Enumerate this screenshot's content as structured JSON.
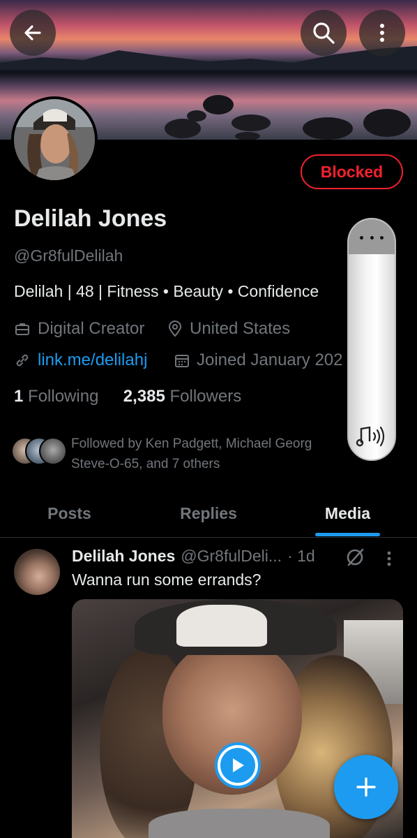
{
  "header": {
    "back_icon": "arrow-left-icon",
    "search_icon": "search-icon",
    "more_icon": "more-vertical-icon"
  },
  "profile": {
    "name": "Delilah Jones",
    "handle": "@Gr8fulDelilah",
    "bio": "Delilah | 48 | Fitness • Beauty • Confidence",
    "category": "Digital Creator",
    "location": "United States",
    "link": "link.me/delilahj",
    "joined": "Joined January 202",
    "following_count": "1",
    "following_label": "Following",
    "followers_count": "2,385",
    "followers_label": "Followers",
    "followed_by_line1": "Followed by Ken Padgett, Michael Georg",
    "followed_by_line2": "Steve-O-65, and 7 others",
    "blocked_label": "Blocked"
  },
  "tabs": [
    {
      "label": "Posts",
      "active": false
    },
    {
      "label": "Replies",
      "active": false
    },
    {
      "label": "Media",
      "active": true
    }
  ],
  "post": {
    "author": "Delilah Jones",
    "handle": "@Gr8fulDeli...",
    "time": "· 1d",
    "text": "Wanna run some errands?"
  },
  "colors": {
    "accent": "#1d9bf0",
    "blocked_red": "#f4212e",
    "text_primary": "#e7e9ea",
    "text_secondary": "#71767b"
  }
}
